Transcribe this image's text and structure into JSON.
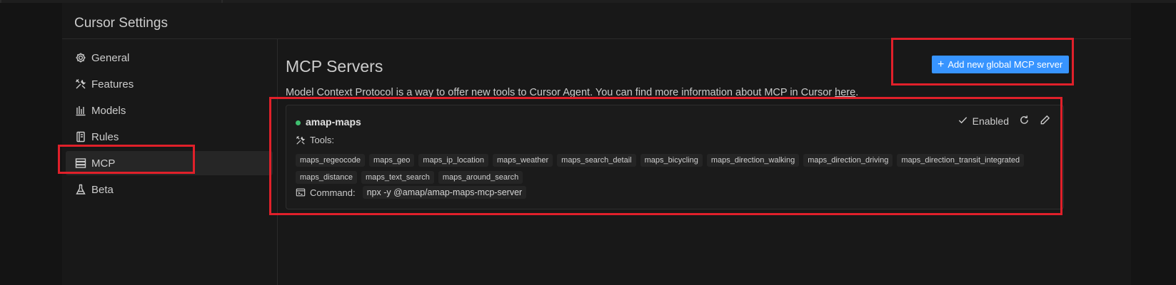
{
  "window": {
    "title": "Cursor Settings"
  },
  "sidebar": {
    "items": [
      {
        "label": "General",
        "icon": "gear-icon"
      },
      {
        "label": "Features",
        "icon": "tools-icon"
      },
      {
        "label": "Models",
        "icon": "bar-chart-icon"
      },
      {
        "label": "Rules",
        "icon": "notebook-icon"
      },
      {
        "label": "MCP",
        "icon": "server-icon",
        "active": true
      },
      {
        "label": "Beta",
        "icon": "flask-icon"
      }
    ]
  },
  "main": {
    "title": "MCP Servers",
    "description": "Model Context Protocol is a way to offer new tools to Cursor Agent. You can find more information about MCP in Cursor ",
    "description_link": "here",
    "description_end": ".",
    "add_button_label": "Add new global MCP server",
    "server": {
      "name": "amap-maps",
      "status_color": "#3fbf6f",
      "enabled_label": "Enabled",
      "tools_label": "Tools:",
      "tools": [
        "maps_regeocode",
        "maps_geo",
        "maps_ip_location",
        "maps_weather",
        "maps_search_detail",
        "maps_bicycling",
        "maps_direction_walking",
        "maps_direction_driving",
        "maps_direction_transit_integrated",
        "maps_distance",
        "maps_text_search",
        "maps_around_search"
      ],
      "command_label": "Command:",
      "command_value": "npx -y @amap/amap-maps-mcp-server"
    }
  },
  "colors": {
    "accent": "#3794ff",
    "highlight": "#e0202a"
  }
}
